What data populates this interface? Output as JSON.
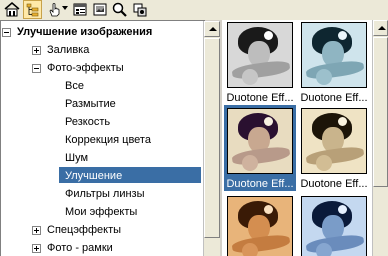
{
  "toolbar": {
    "buttons": [
      {
        "icon": "home-icon"
      },
      {
        "icon": "folder-tree-icon",
        "active": true
      },
      {
        "icon": "hand-pointer-icon",
        "dropdown": true
      },
      {
        "icon": "properties-icon"
      },
      {
        "icon": "image-view-icon"
      },
      {
        "icon": "search-icon"
      },
      {
        "icon": "copy-icon"
      }
    ]
  },
  "tree": {
    "root": "Улучшение изображения",
    "items": [
      {
        "label": "Заливка",
        "state": "collapsed"
      },
      {
        "label": "Фото-эффекты",
        "state": "expanded"
      },
      {
        "label": "Все"
      },
      {
        "label": "Размытие"
      },
      {
        "label": "Резкость"
      },
      {
        "label": "Коррекция цвета"
      },
      {
        "label": "Шум"
      },
      {
        "label": "Улучшение",
        "selected": true
      },
      {
        "label": "Фильтры линзы"
      },
      {
        "label": "Мои эффекты"
      },
      {
        "label": "Спецэффекты",
        "state": "collapsed"
      },
      {
        "label": "Фото - рамки",
        "state": "collapsed"
      }
    ]
  },
  "thumbnails": [
    {
      "caption": "Duotone Eff...",
      "tone": "bw"
    },
    {
      "caption": "Duotone Eff...",
      "tone": "cyan"
    },
    {
      "caption": "Duotone Eff...",
      "tone": "purple",
      "selected": true
    },
    {
      "caption": "Duotone Eff...",
      "tone": "sepia"
    },
    {
      "caption": "",
      "tone": "orange"
    },
    {
      "caption": "",
      "tone": "blue"
    }
  ],
  "colors": {
    "selection": "#3a6ea5",
    "panel_bg": "#ece9d8"
  }
}
